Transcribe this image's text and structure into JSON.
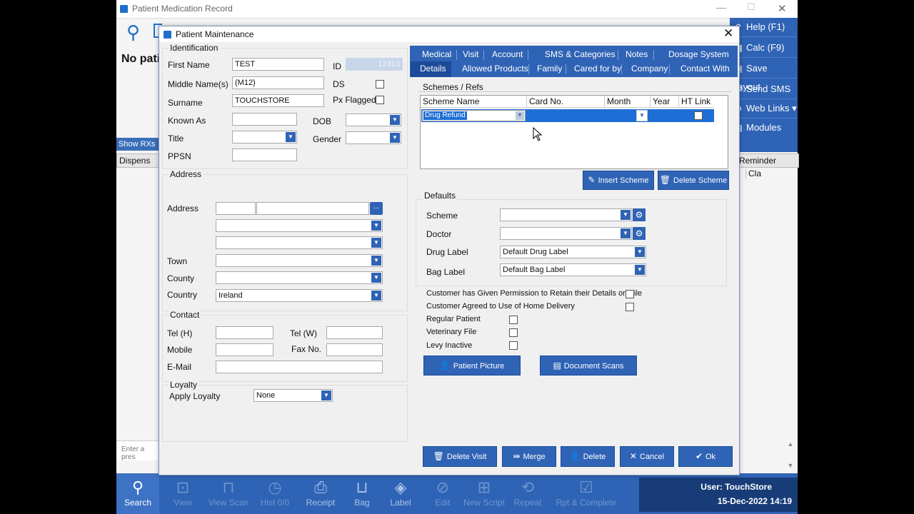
{
  "background": {
    "title": "Patient Medication Record",
    "no_patient_text": "No pati",
    "show_rxs": "Show RXs",
    "dispense_col": "Dispens",
    "reminder_col": "Reminder",
    "cla_col": "Cla",
    "enter_prescription": "Enter a pres",
    "right_panel": [
      {
        "icon": "help-icon",
        "label": "Help (F1)"
      },
      {
        "icon": "calculator-icon",
        "label": "Calc (F9)"
      },
      {
        "icon": "save-icon",
        "label": "Save Layout"
      },
      {
        "icon": "sms-icon",
        "label": "Send SMS"
      },
      {
        "icon": "web-icon",
        "label": "Web Links ▾"
      },
      {
        "icon": "modules-icon",
        "label": "Modules"
      }
    ],
    "toolbar": [
      {
        "icon": "search-icon",
        "label": "Search"
      },
      {
        "icon": "view-icon",
        "label": "View"
      },
      {
        "icon": "scan-icon",
        "label": "View Scan"
      },
      {
        "icon": "history-icon",
        "label": "Hist 0/0"
      },
      {
        "icon": "receipt-icon",
        "label": "Receipt"
      },
      {
        "icon": "bag-icon",
        "label": "Bag"
      },
      {
        "icon": "label-icon",
        "label": "Label"
      },
      {
        "icon": "edit-icon",
        "label": "Edit"
      },
      {
        "icon": "new-script-icon",
        "label": "New Script"
      },
      {
        "icon": "repeat-icon",
        "label": "Repeat"
      },
      {
        "icon": "complete-icon",
        "label": "Rpt & Complete"
      }
    ],
    "user": "User: TouchStore",
    "datetime": "15-Dec-2022  14:19"
  },
  "dialog": {
    "title": "Patient Maintenance",
    "identification": {
      "group": "Identification",
      "first_name_label": "First Name",
      "first_name": "TEST",
      "id_label": "ID",
      "id_value": "12313",
      "middle_label": "Middle Name(s)",
      "middle": "(M12)",
      "ds_label": "DS",
      "surname_label": "Surname",
      "surname": "TOUCHSTORE",
      "px_flagged_label": "Px Flagged",
      "known_as_label": "Known As",
      "dob_label": "DOB",
      "title_label": "Title",
      "gender_label": "Gender",
      "ppsn_label": "PPSN"
    },
    "address": {
      "group": "Address",
      "address_label": "Address",
      "browse_btn": "...",
      "town_label": "Town",
      "county_label": "County",
      "country_label": "Country",
      "country": "Ireland"
    },
    "contact": {
      "group": "Contact",
      "tel_h_label": "Tel (H)",
      "tel_w_label": "Tel (W)",
      "mobile_label": "Mobile",
      "fax_label": "Fax No.",
      "email_label": "E-Mail"
    },
    "loyalty": {
      "group": "Loyalty",
      "apply_label": "Apply Loyalty",
      "value": "None"
    },
    "tabs_row1": [
      "Medical",
      "Visit",
      "Account",
      "SMS & Categories",
      "Notes",
      "Dosage System"
    ],
    "tabs_row2": [
      "Details",
      "Allowed Products",
      "Family",
      "Cared for by",
      "Company",
      "Contact With"
    ],
    "schemes": {
      "group": "Schemes / Refs",
      "columns": [
        "Scheme Name",
        "Card No.",
        "Month",
        "Year",
        "HT Link"
      ],
      "row_scheme": "Drug Refund",
      "insert_btn": "Insert Scheme",
      "delete_btn": "Delete Scheme"
    },
    "defaults": {
      "group": "Defaults",
      "scheme_label": "Scheme",
      "doctor_label": "Doctor",
      "drug_label_label": "Drug Label",
      "drug_label": "Default Drug Label",
      "bag_label_label": "Bag Label",
      "bag_label": "Default Bag Label"
    },
    "checks": {
      "permission": "Customer has Given Permission to Retain their Details on File",
      "home_delivery": "Customer Agreed to Use of Home Delivery",
      "regular": "Regular Patient",
      "veterinary": "Veterinary File",
      "levy": "Levy Inactive"
    },
    "patient_picture_btn": "Patient Picture",
    "document_scans_btn": "Document Scans",
    "footer": {
      "delete_visit": "Delete Visit",
      "merge": "Merge",
      "delete": "Delete",
      "cancel": "Cancel",
      "ok": "Ok"
    }
  }
}
